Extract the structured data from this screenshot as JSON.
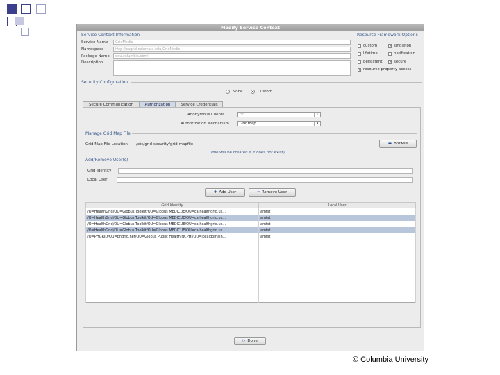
{
  "window": {
    "title": "Modify Service Context"
  },
  "service_context": {
    "section_label": "Service Context Information",
    "service_name_label": "Service Name",
    "service_name_value": "GridMedic",
    "namespace_label": "Namespace",
    "namespace_value": "http://cagrid.columbia.edu/GridMedic",
    "package_name_label": "Package Name",
    "package_name_value": "edu.columbia.cbmi",
    "description_label": "Description",
    "description_value": ""
  },
  "resource_framework": {
    "section_label": "Resource Framework Options",
    "options": [
      {
        "label": "custom",
        "checked": false
      },
      {
        "label": "singleton",
        "checked": true
      },
      {
        "label": "lifetime",
        "checked": false
      },
      {
        "label": "notification",
        "checked": false
      },
      {
        "label": "persistent",
        "checked": false
      },
      {
        "label": "secure",
        "checked": true
      },
      {
        "label": "resource property access",
        "checked": true
      }
    ]
  },
  "security": {
    "section_label": "Security Configuration",
    "radio_none": "None",
    "radio_custom": "Custom",
    "selected": "Custom"
  },
  "tabs": [
    {
      "label": "Secure Communication"
    },
    {
      "label": "Authorization"
    },
    {
      "label": "Service Credentials"
    }
  ],
  "authorization": {
    "anonymous_label": "Anonymous Clients",
    "anonymous_value": "no",
    "mechanism_label": "Authorization Mechanism",
    "mechanism_value": "Gridmap"
  },
  "gridmap": {
    "section_label": "Manage Grid Map File",
    "location_label": "Grid Map File Location",
    "location_value": "/etc/grid-security/grid-mapfile",
    "note": "(file will be created if it does not exist)",
    "browse_label": "Browse"
  },
  "add_remove": {
    "section_label": "Add/Remove User(s)",
    "grid_identity_label": "Grid Identity",
    "local_user_label": "Local User",
    "add_label": "Add User",
    "remove_label": "Remove User"
  },
  "table": {
    "columns": [
      "Grid Identity",
      "Local User"
    ],
    "rows": [
      {
        "identity": "/O=HealthGrid/OU=Globus Toolkit/OU=Globus MEDICUE/OU=ca.healthgrid.us...",
        "user": "amtst",
        "selected": false
      },
      {
        "identity": "/O=HealthGrid/OU=Globus Toolkit/OU=Globus MEDICUE/OU=ca.healthgrid.us...",
        "user": "amtst",
        "selected": true
      },
      {
        "identity": "/O=HealthGrid/OU=Globus Toolkit/OU=Globus MEDICUE/OU=ca.healthgrid.us...",
        "user": "amtst",
        "selected": false
      },
      {
        "identity": "/O=HealthGrid/OU=Globus Toolkit/OU=Globus MEDICUE/OU=ca.healthgrid.us...",
        "user": "amtst",
        "selected": true
      },
      {
        "identity": "/O=PHGRID/OU=phgrid.net/OU=Globus Public Health NCPHI/OU=localdomain...",
        "user": "amtst",
        "selected": false
      }
    ]
  },
  "footer": {
    "done_label": "Done"
  },
  "copyright": "© Columbia University",
  "colors": {
    "accent": "#3b3f8c",
    "section_label": "#3a5a8c",
    "selected_row": "#b8c6dc"
  }
}
